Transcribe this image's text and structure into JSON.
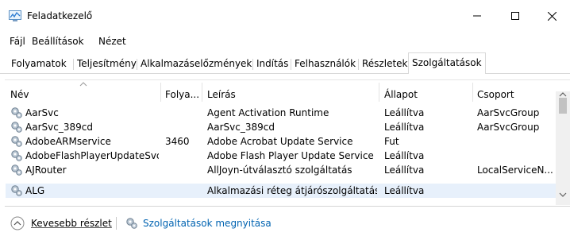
{
  "window": {
    "title": "Feladatkezelő",
    "controls": {
      "minimize": "minimize-icon",
      "maximize": "maximize-icon",
      "close": "close-icon"
    }
  },
  "menu": [
    "Fájl",
    "Beállítások",
    "Nézet"
  ],
  "tabs": [
    {
      "label": "Folyamatok",
      "active": false
    },
    {
      "label": "Teljesítmény",
      "active": false
    },
    {
      "label": "Alkalmazáselőzmények",
      "active": false
    },
    {
      "label": "Indítás",
      "active": false
    },
    {
      "label": "Felhasználók",
      "active": false
    },
    {
      "label": "Részletek",
      "active": false
    },
    {
      "label": "Szolgáltatások",
      "active": true
    }
  ],
  "table": {
    "columns": [
      "Név",
      "Folya...",
      "Leírás",
      "Állapot",
      "Csoport"
    ],
    "rows": [
      {
        "name": "AarSvc",
        "pid": "",
        "description": "Agent Activation Runtime",
        "status": "Leállítva",
        "group": "AarSvcGroup"
      },
      {
        "name": "AarSvc_389cd",
        "pid": "",
        "description": "AarSvc_389cd",
        "status": "Leállítva",
        "group": "AarSvcGroup"
      },
      {
        "name": "AdobeARMservice",
        "pid": "3460",
        "description": "Adobe Acrobat Update Service",
        "status": "Fut",
        "group": ""
      },
      {
        "name": "AdobeFlashPlayerUpdateSvc",
        "pid": "",
        "description": "Adobe Flash Player Update Service",
        "status": "Leállítva",
        "group": ""
      },
      {
        "name": "AJRouter",
        "pid": "",
        "description": "AllJoyn-útválasztó szolgáltatás",
        "status": "Leállítva",
        "group": "LocalServiceN..."
      },
      {
        "name": "ALG",
        "pid": "",
        "description": "Alkalmazási réteg átjárószolgáltatása",
        "status": "Leállítva",
        "group": ""
      }
    ],
    "selected_row": 5
  },
  "footer": {
    "fewer_details": "Kevesebb részlet",
    "open_services": "Szolgáltatások megnyitása"
  },
  "colors": {
    "accent": "#0063b1",
    "selection": "#e7f0fb"
  }
}
